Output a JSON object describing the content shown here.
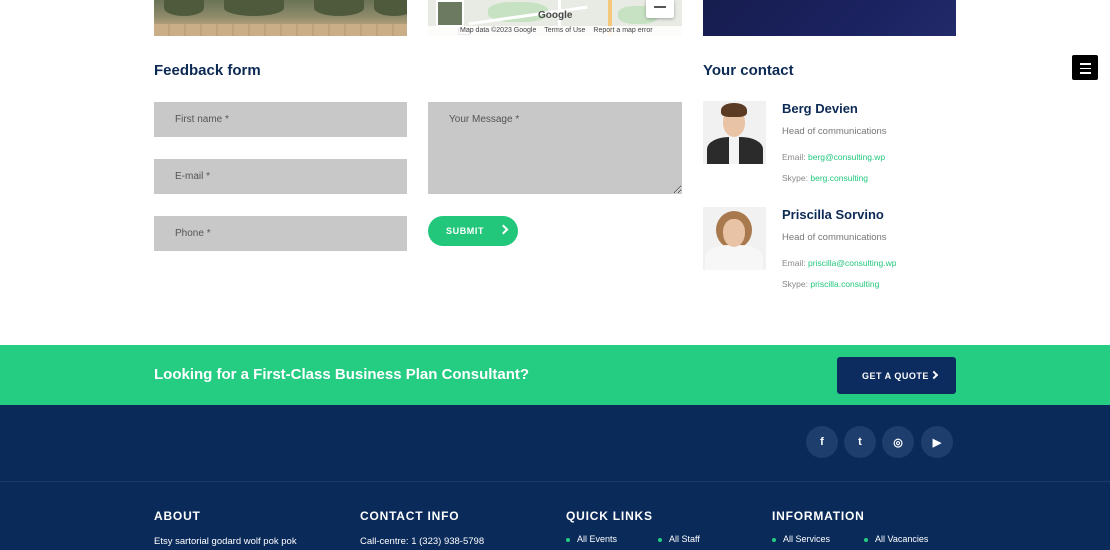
{
  "map": {
    "logo": "Google",
    "attribution": [
      "Map data ©2023 Google",
      "Terms of Use",
      "Report a map error"
    ]
  },
  "feedback": {
    "title": "Feedback form",
    "first_name_placeholder": "First name *",
    "email_placeholder": "E-mail *",
    "phone_placeholder": "Phone *",
    "message_placeholder": "Your Message *",
    "submit_label": "SUBMIT"
  },
  "contact": {
    "title": "Your contact",
    "people": [
      {
        "name": "Berg Devien",
        "role": "Head of communications",
        "email_label": "Email:",
        "email": "berg@consulting.wp",
        "skype_label": "Skype:",
        "skype": "berg.consulting"
      },
      {
        "name": "Priscilla Sorvino",
        "role": "Head of communications",
        "email_label": "Email:",
        "email": "priscilla@consulting.wp",
        "skype_label": "Skype:",
        "skype": "priscilla.consulting"
      }
    ]
  },
  "cta": {
    "text": "Looking for a First-Class Business Plan Consultant?",
    "button_label": "GET A QUOTE"
  },
  "footer": {
    "social": [
      {
        "icon": "facebook-icon",
        "glyph": "f"
      },
      {
        "icon": "twitter-icon",
        "glyph": "t"
      },
      {
        "icon": "instagram-icon",
        "glyph": "◎"
      },
      {
        "icon": "youtube-icon",
        "glyph": "▶"
      }
    ],
    "about_title": "ABOUT",
    "about_text": "Etsy sartorial godard wolf pok pok",
    "contact_title": "CONTACT INFO",
    "contact_text": "Call-centre: 1 (323) 938-5798",
    "quick_links_title": "QUICK LINKS",
    "quick_links": [
      "All Events",
      "All Staff"
    ],
    "information_title": "INFORMATION",
    "information_links": [
      "All Services",
      "All Vacancies"
    ]
  },
  "colors": {
    "navy": "#0d2a55",
    "green": "#22c77c",
    "footer_bg": "#0a2a5a"
  }
}
